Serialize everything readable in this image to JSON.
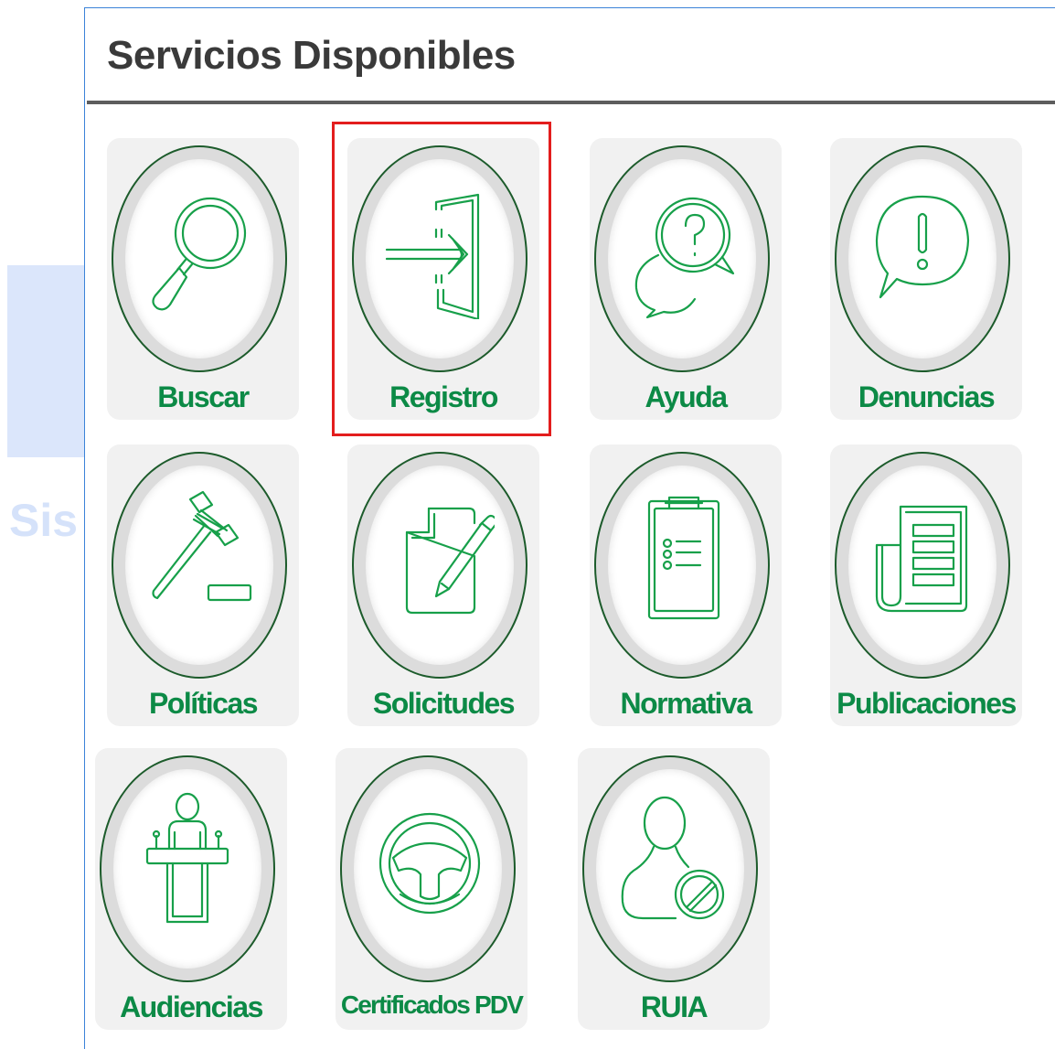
{
  "watermark": {
    "text": "Sis"
  },
  "panel": {
    "title": "Servicios Disponibles"
  },
  "services": [
    {
      "label": "Buscar",
      "icon": "search-icon"
    },
    {
      "label": "Registro",
      "icon": "sign-in-icon",
      "highlighted": true
    },
    {
      "label": "Ayuda",
      "icon": "help-chat-icon"
    },
    {
      "label": "Denuncias",
      "icon": "alert-chat-icon"
    },
    {
      "label": "Políticas",
      "icon": "gavel-icon"
    },
    {
      "label": "Solicitudes",
      "icon": "document-edit-icon"
    },
    {
      "label": "Normativa",
      "icon": "clipboard-list-icon"
    },
    {
      "label": "Publicaciones",
      "icon": "newspaper-icon"
    },
    {
      "label": "Audiencias",
      "icon": "podium-speaker-icon"
    },
    {
      "label": "Certificados PDV",
      "icon": "steering-wheel-icon"
    },
    {
      "label": "RUIA",
      "icon": "user-blocked-icon"
    }
  ],
  "colors": {
    "accent_green": "#0c8a46",
    "icon_stroke": "#17a04a",
    "highlight_red": "#e31d1d",
    "frame_blue": "#3b83d8"
  }
}
